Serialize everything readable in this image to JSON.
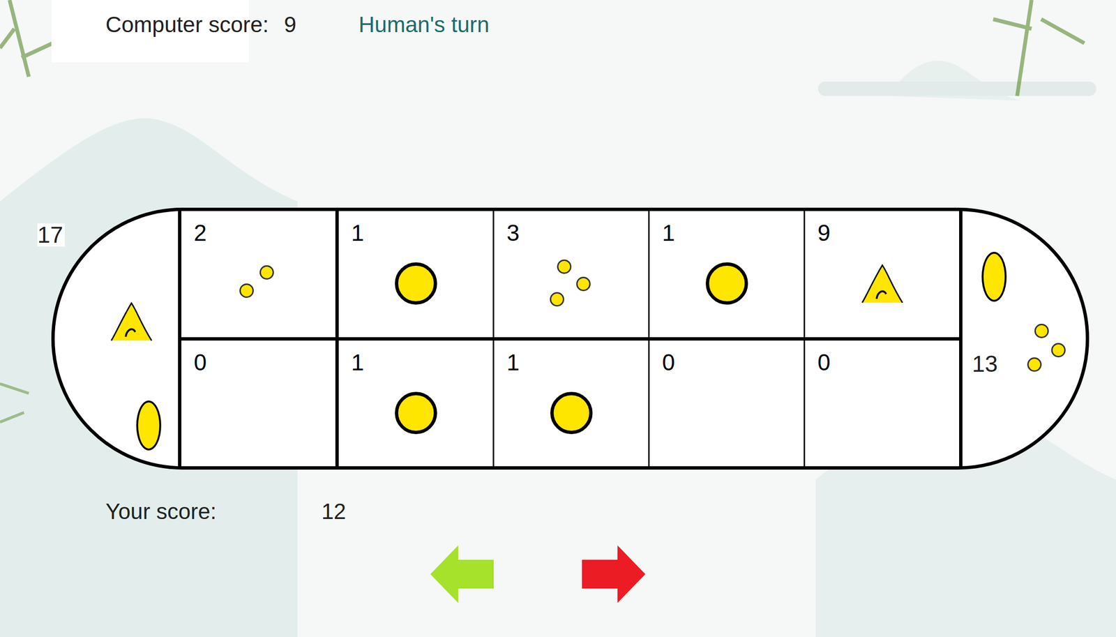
{
  "scores": {
    "computer_label": "Computer score:",
    "computer": "9",
    "human_label": "Your score:",
    "human": "12"
  },
  "turn": "Human's turn",
  "board": {
    "left_store": {
      "count": "17",
      "pieces": [
        "mound",
        "oval"
      ]
    },
    "right_store": {
      "count": "13",
      "pieces": [
        "oval",
        "dot",
        "dot",
        "dot"
      ]
    },
    "top_row": [
      {
        "count": "2",
        "kind": "dots"
      },
      {
        "count": "1",
        "kind": "stone"
      },
      {
        "count": "3",
        "kind": "dots"
      },
      {
        "count": "1",
        "kind": "stone"
      },
      {
        "count": "9",
        "kind": "mound"
      }
    ],
    "bottom_row": [
      {
        "count": "0",
        "kind": "empty"
      },
      {
        "count": "1",
        "kind": "stone"
      },
      {
        "count": "1",
        "kind": "stone"
      },
      {
        "count": "0",
        "kind": "empty"
      },
      {
        "count": "0",
        "kind": "empty"
      }
    ]
  },
  "arrows": [
    {
      "direction": "left",
      "color": "#a6e12b"
    },
    {
      "direction": "right",
      "color": "#ec1c24"
    }
  ]
}
